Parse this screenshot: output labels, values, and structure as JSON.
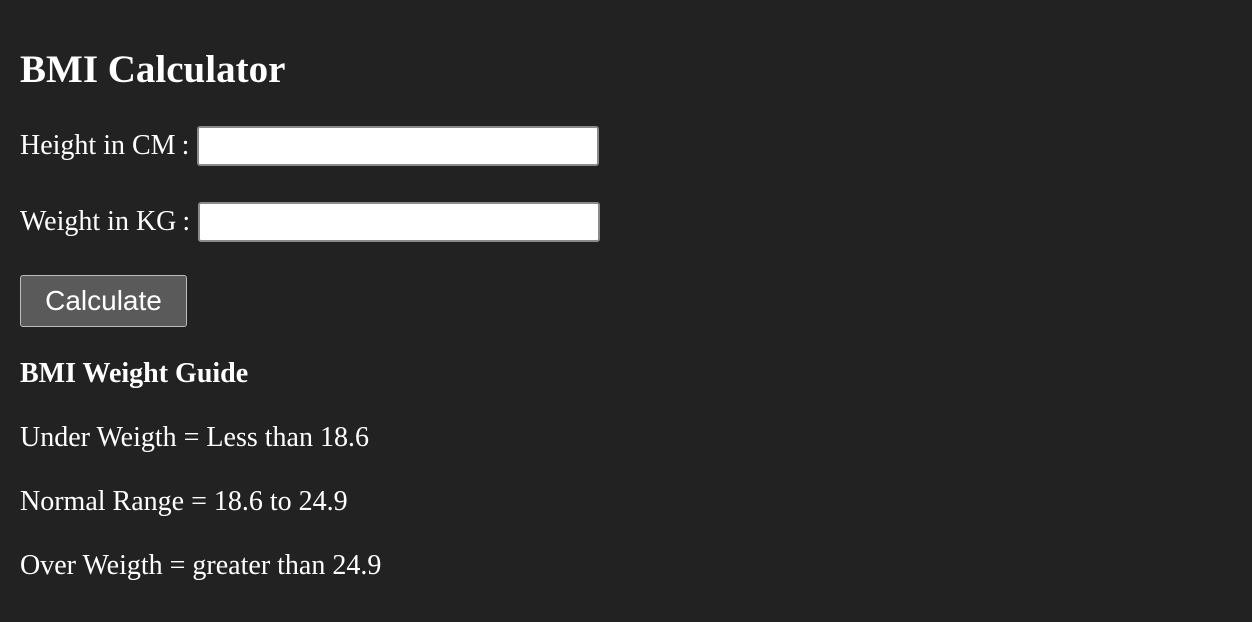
{
  "page": {
    "title": "BMI Calculator",
    "background_color": "#222222",
    "text_color": "#ffffff"
  },
  "form": {
    "height_label": "Height in CM",
    "weight_label": "Weight in KG",
    "separator": ":",
    "height_value": "",
    "weight_value": "",
    "calculate_label": "Calculate"
  },
  "guide": {
    "heading": "BMI Weight Guide",
    "items": [
      "Under Weigth = Less than 18.6",
      "Normal Range = 18.6 to 24.9",
      "Over Weigth = greater than 24.9"
    ]
  }
}
